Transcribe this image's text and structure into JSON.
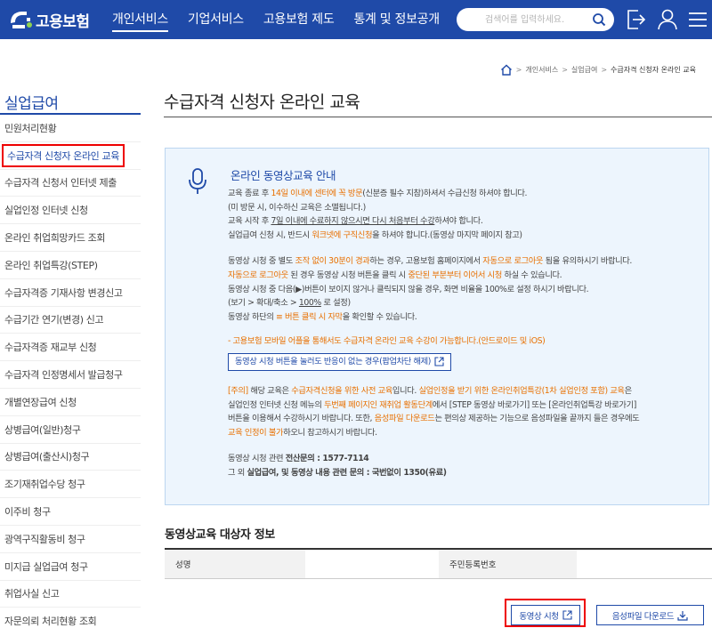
{
  "header": {
    "logo_text": "고용보험",
    "nav": [
      "개인서비스",
      "기업서비스",
      "고용보험 제도",
      "통계 및 정보공개"
    ],
    "search_placeholder": "검색어를 입력하세요.",
    "colors": {
      "primary": "#1f4aa8",
      "accent_orange": "#e87000",
      "highlight_red": "#e00000"
    }
  },
  "breadcrumb": {
    "items": [
      "개인서비스",
      "실업급여",
      "수급자격 신청자 온라인 교육"
    ]
  },
  "sidebar": {
    "title": "실업급여",
    "items": [
      "민원처리현황",
      "수급자격 신청자 온라인 교육",
      "수급자격 신청서 인터넷 제출",
      "실업인정 인터넷 신청",
      "온라인 취업희망카드 조회",
      "온라인 취업특강(STEP)",
      "수급자격증 기재사항 변경신고",
      "수급기간 연기(변경) 신고",
      "수급자격증 재교부 신청",
      "수급자격 인정명세서 발급청구",
      "개별연장급여 신청",
      "상병급여(일반)청구",
      "상병급여(출산시)청구",
      "조기재취업수당 청구",
      "이주비 청구",
      "광역구직활동비 청구",
      "미지급 실업급여 청구",
      "취업사실 신고",
      "자문의뢰 처리현황 조회"
    ],
    "active_index": 1
  },
  "main": {
    "title": "수급자격 신청자 온라인 교육",
    "notice": {
      "title": "온라인 동영상교육 안내",
      "l1a": "교육 종료 후 ",
      "l1b": "14일 이내에 센터에 꼭 방문",
      "l1c": "(신분증 필수 지참)하셔서 수급신청 하셔야 합니다.",
      "l2": "(미 방문 시, 이수하신 교육은 소멸됩니다.)",
      "l3a": "교육 시작 후 ",
      "l3b": "7일 이내에 수료하지 않으시면 다시 처음부터 수강",
      "l3c": "하셔야 합니다.",
      "l4a": "실업급여 신청 시, 반드시 ",
      "l4b": "워크넷에 구직신청",
      "l4c": "을 하셔야 합니다.(동영상 마지막 페이지 참고)",
      "l5a": "동영상 시청 중 별도 ",
      "l5b": "조작 없이 30분이 경과",
      "l5c": "하는 경우, 고용보험 홈페이지에서 ",
      "l5d": "자동으로 로그아웃",
      "l5e": " 됨을 유의하시기 바랍니다.",
      "l6a": "자동으로 로그아웃",
      "l6b": " 된 경우 동영상 시청 버튼을 클릭 시 ",
      "l6c": "중단된 부분부터 이어서 시청",
      "l6d": " 하실 수 있습니다.",
      "l7": "동영상 시청 중 다음(▶)버튼이 보이지 않거나 클릭되지 않을 경우, 화면 비율을 100%로 설정 하시기 바랍니다.",
      "l8a": "(보기 > 확대/축소 > ",
      "l8b": "100%",
      "l8c": " 로 설정)",
      "l9a": "동영상 하단의 ",
      "l9b": "≡ 버튼 클릭 시 자막",
      "l9c": "을 확인할 수 있습니다.",
      "mobile": "- 고용보험 모바일 어플을 통해서도 수급자격 온라인 교육 수강이 가능합니다.(안드로이드 및 iOS)",
      "popup_button": "동영상 시청 버튼을 눌러도 반응이 없는 경우(팝업차단 해제)",
      "w1a": "[주의]",
      "w1b": " 해당 교육은 ",
      "w1c": "수급자격신청을 위한 사전 교육",
      "w1d": "입니다. ",
      "w1e": "실업인정을 받기 위한 온라인취업특강(1차 실업인정 포함) 교육",
      "w1f": "은",
      "w2a": "실업인정 인터넷 신청 메뉴의 ",
      "w2b": "두번째 페이지인 재취업 활동단계",
      "w2c": "에서 [STEP 동영상 바로가기] 또는 [온라인취업특강 바로가기]",
      "w3a": "버튼을 이용해서 수강하시기 바랍니다. 또한, ",
      "w3b": "음성파일 다운로드",
      "w3c": "는 편의상 제공하는 기능으로 음성파일을 끝까지 들은 경우에도",
      "w4a": "교육 인정이 불가",
      "w4b": "하오니 참고하시기 바랍니다.",
      "c1a": "동영상 시청 관련 ",
      "c1b": "전산문의 : 1577-7114",
      "c2a": "그 외 ",
      "c2b": "실업급여, 및 동영상 내용 관련 문의 : 국번없이 1350(유료)"
    },
    "section_title": "동영상교육 대상자 정보",
    "table": {
      "name_label": "성명",
      "id_label": "주민등록번호"
    },
    "buttons": {
      "watch": "동영상 시청",
      "download": "음성파일 다운로드"
    }
  }
}
